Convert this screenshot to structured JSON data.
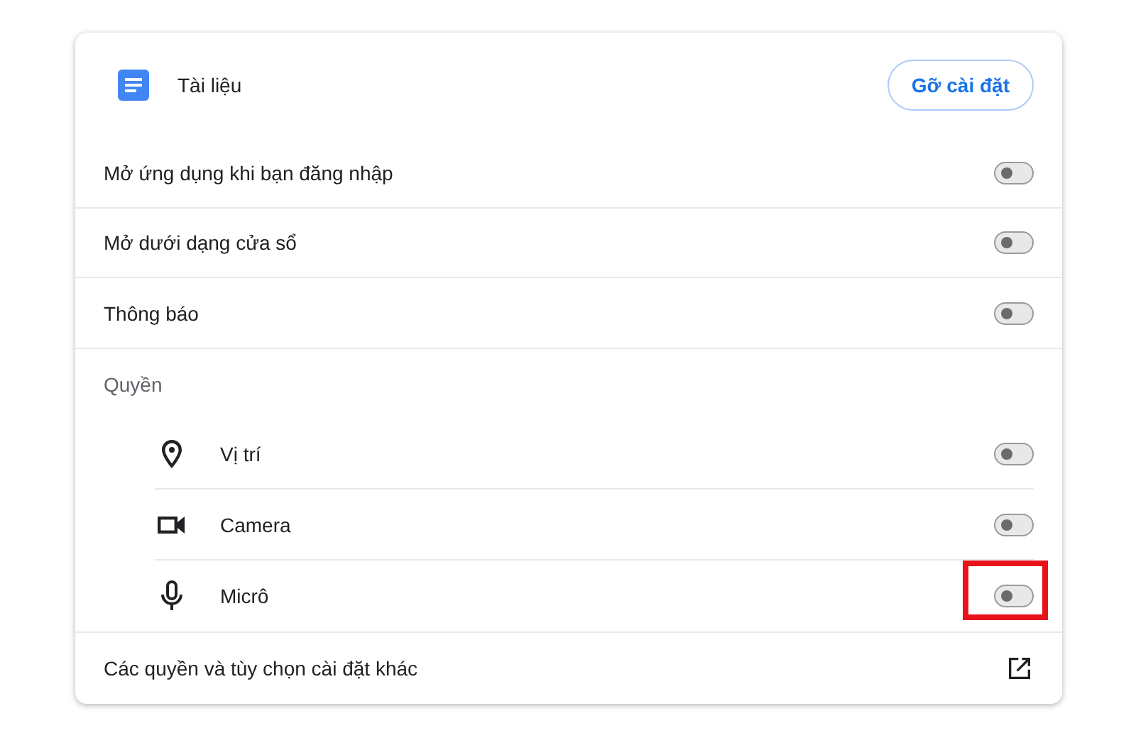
{
  "app": {
    "title": "Tài liệu",
    "uninstall_button": "Gỡ cài đặt"
  },
  "settings": [
    {
      "label": "Mở ứng dụng khi bạn đăng nhập",
      "on": false
    },
    {
      "label": "Mở dưới dạng cửa sổ",
      "on": false
    },
    {
      "label": "Thông báo",
      "on": false
    }
  ],
  "permissions": {
    "heading": "Quyền",
    "items": [
      {
        "kind": "location",
        "label": "Vị trí",
        "on": false,
        "highlighted": false
      },
      {
        "kind": "camera",
        "label": "Camera",
        "on": false,
        "highlighted": false
      },
      {
        "kind": "microphone",
        "label": "Micrô",
        "on": false,
        "highlighted": true
      }
    ]
  },
  "more_link": {
    "label": "Các quyền và tùy chọn cài đặt khác"
  }
}
